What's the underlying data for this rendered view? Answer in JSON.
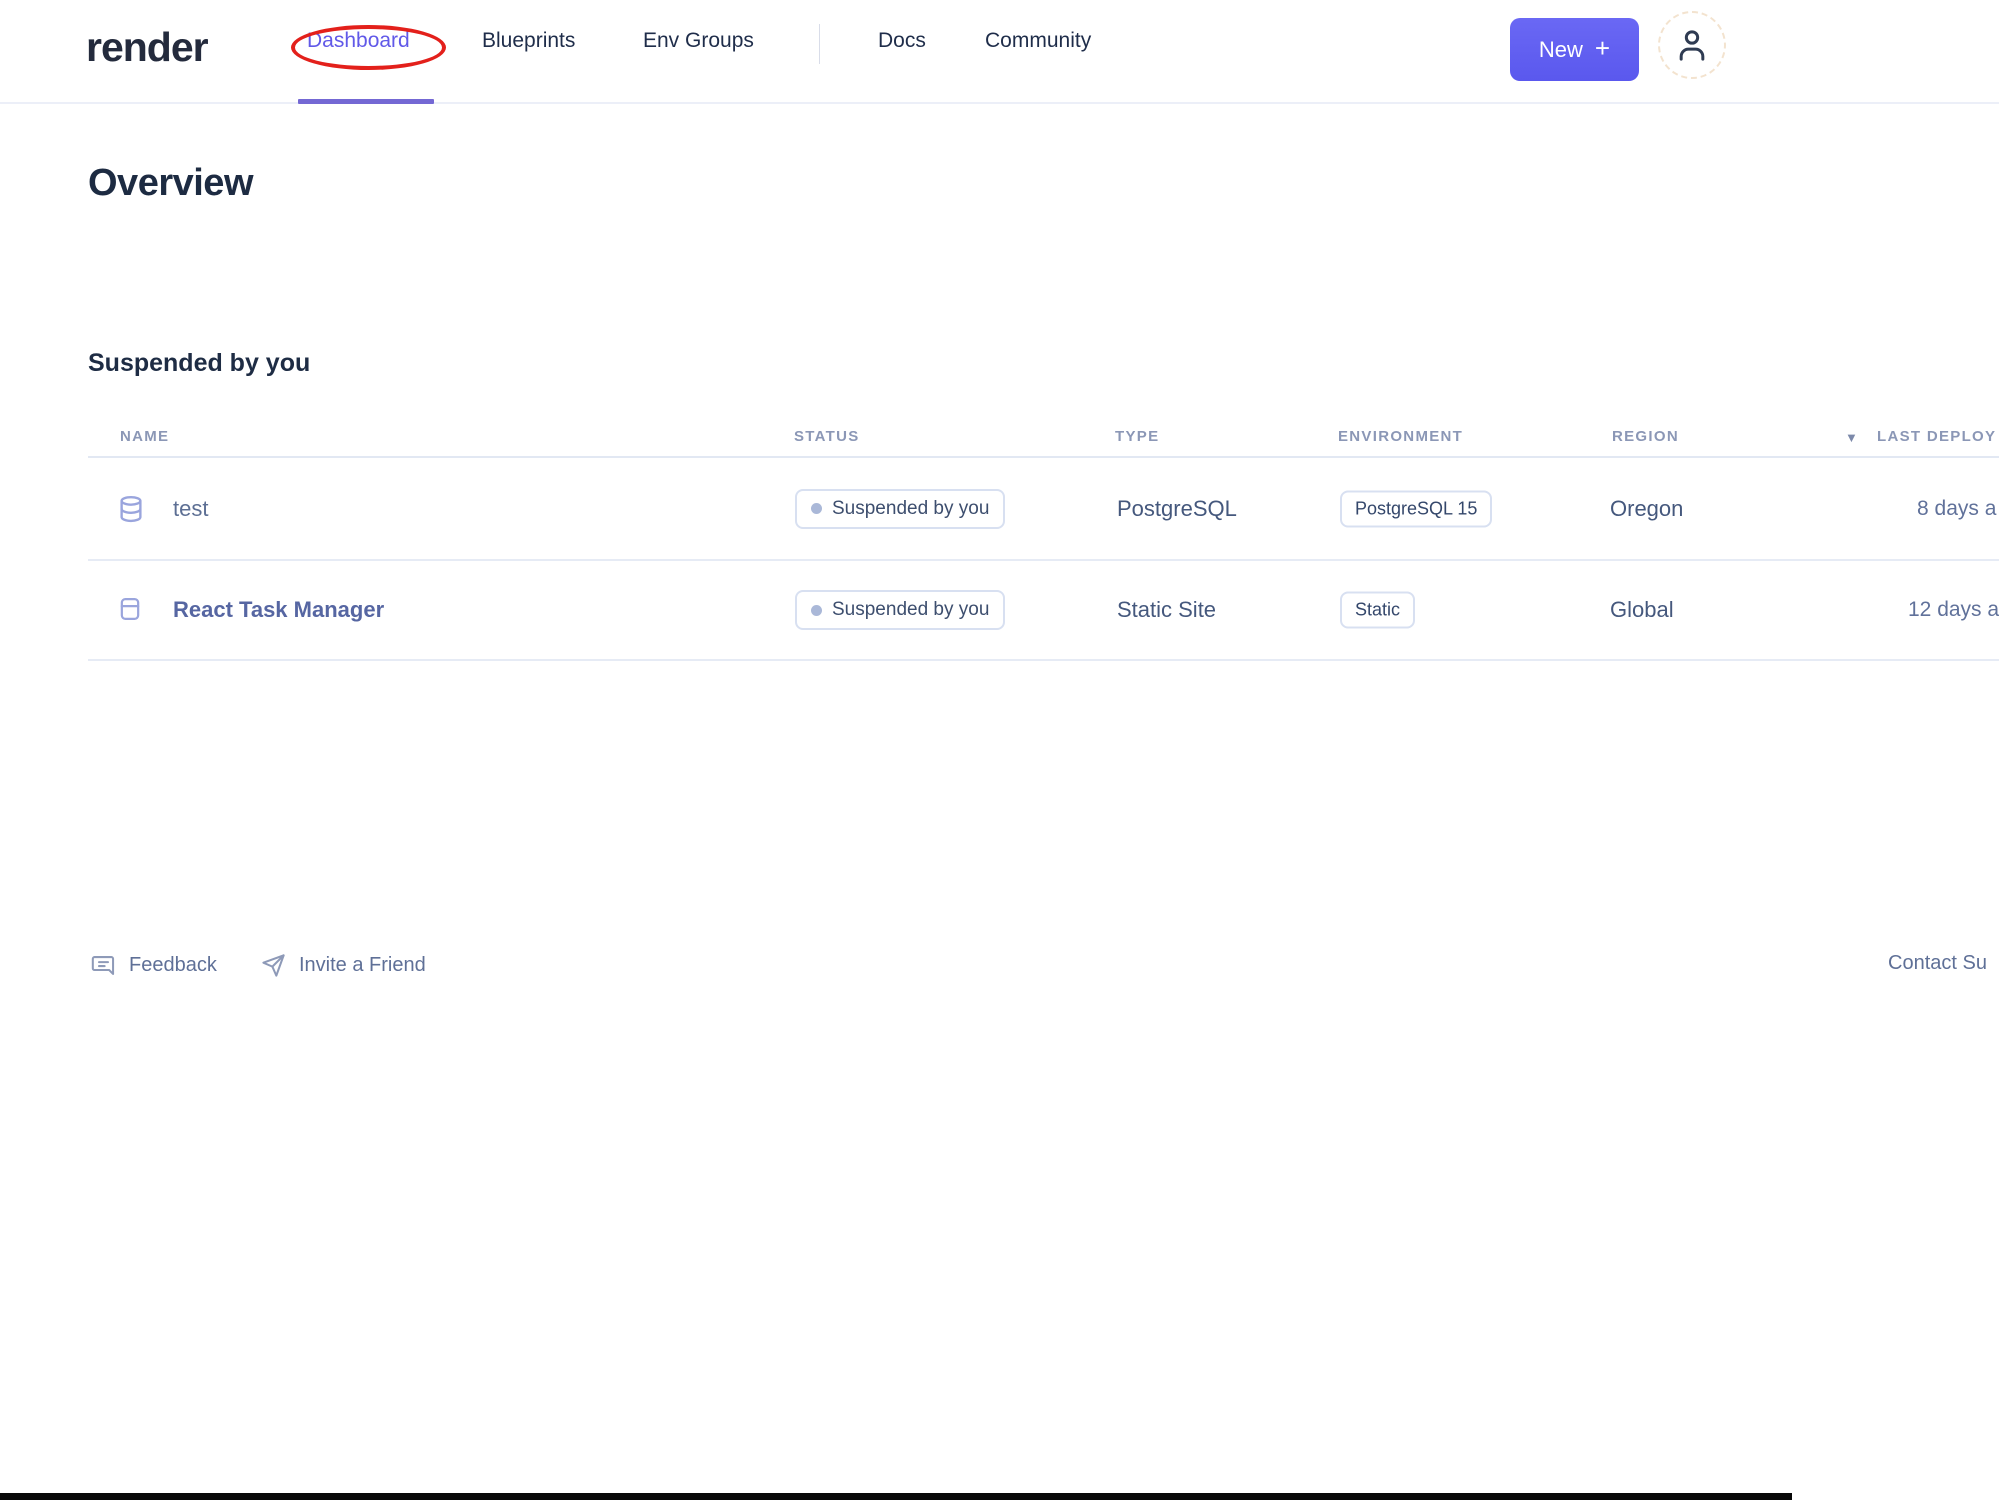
{
  "brand": {
    "logo_text": "render"
  },
  "nav": {
    "items": [
      {
        "label": "Dashboard",
        "active": true,
        "annotated": "red-circle"
      },
      {
        "label": "Blueprints"
      },
      {
        "label": "Env Groups"
      },
      {
        "label": "Docs"
      },
      {
        "label": "Community"
      }
    ],
    "new_button": {
      "label": "New",
      "plus": "+"
    },
    "user_menu_icon": "person-icon"
  },
  "page": {
    "title": "Overview",
    "section_heading": "Suspended by you"
  },
  "table": {
    "columns": {
      "name": "NAME",
      "status": "STATUS",
      "type": "TYPE",
      "environment": "ENVIRONMENT",
      "region": "REGION",
      "last_deploy": "LAST DEPLOY",
      "sort_icon": "▼"
    },
    "rows": [
      {
        "icon": "database-icon",
        "name": "test",
        "status": "Suspended by you",
        "type": "PostgreSQL",
        "environment": "PostgreSQL 15",
        "region": "Oregon",
        "last_deploy": "8 days a"
      },
      {
        "icon": "static-site-icon",
        "name": "React Task Manager",
        "status": "Suspended by you",
        "type": "Static Site",
        "environment": "Static",
        "region": "Global",
        "last_deploy": "12 days a"
      }
    ]
  },
  "footer": {
    "feedback": "Feedback",
    "invite": "Invite a Friend",
    "contact_support": "Contact Su"
  },
  "colors": {
    "accent_purple": "#605ef0",
    "active_nav_purple": "#6159e8",
    "annotation_red": "#e3201b",
    "nav_text": "#1f2d4a",
    "table_header_text": "#8b97b6",
    "badge_border": "#d8e0f1",
    "cell_text": "#45587d"
  }
}
